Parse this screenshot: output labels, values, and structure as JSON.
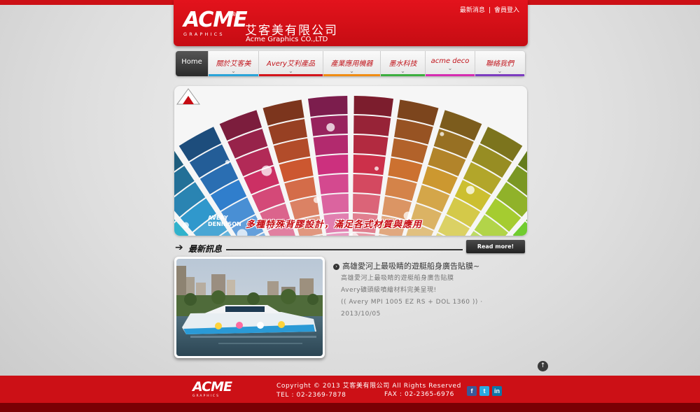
{
  "header": {
    "logo_main": "ACME",
    "logo_sub": "GRAPHICS",
    "logo_reg": "®",
    "company_cn": "艾客美有限公司",
    "company_en": "Acme Graphics CO.,LTD",
    "top_links": [
      "最新消息",
      "會員登入"
    ],
    "top_sep": "|"
  },
  "nav": {
    "items": [
      {
        "label": "Home",
        "color": "#2b2b2b"
      },
      {
        "label": "關於艾客美",
        "color": "#2aa4d8"
      },
      {
        "label": "Avery艾利產品",
        "color": "#d4141b"
      },
      {
        "label": "產業應用機器",
        "color": "#f08c13"
      },
      {
        "label": "墨水科技",
        "color": "#3cae3f"
      },
      {
        "label": "acme deco",
        "color": "#d62cb1"
      },
      {
        "label": "聯絡我們",
        "color": "#7c3cc0"
      }
    ],
    "chevron": "⌄"
  },
  "banner": {
    "caption": "多種特殊背膠設計，滿足各式材質與應用",
    "brand_line1": "AVERY",
    "brand_line2": "DENNISON"
  },
  "news": {
    "heading": "最新訊息",
    "read_more": "Read more!",
    "item_title": "高雄愛河上最吸睛的遊艇船身廣告貼膜~",
    "item_lines": [
      "高雄愛河上最吸睛的遊艇船身廣告貼膜",
      "Avery礦頭級噴繪材料完美呈現!",
      "(( Avery MPI 1005 EZ RS + DOL 1360 )) ·",
      "2013/10/05"
    ]
  },
  "footer": {
    "logo_main": "ACME",
    "logo_sub": "GRAPHICS",
    "copyright": "Copyright © 2013 艾客美有限公司  All Rights Reserved",
    "tel": "TEL : 02-2369-7878",
    "fax": "FAX : 02-2365-6976",
    "social": [
      {
        "icon": "facebook-icon",
        "glyph": "f",
        "color": "#3b5998"
      },
      {
        "icon": "twitter-icon",
        "glyph": "t",
        "color": "#2aa9e0"
      },
      {
        "icon": "linkedin-icon",
        "glyph": "in",
        "color": "#0e76a8"
      }
    ]
  },
  "back_to_top_glyph": "↑"
}
